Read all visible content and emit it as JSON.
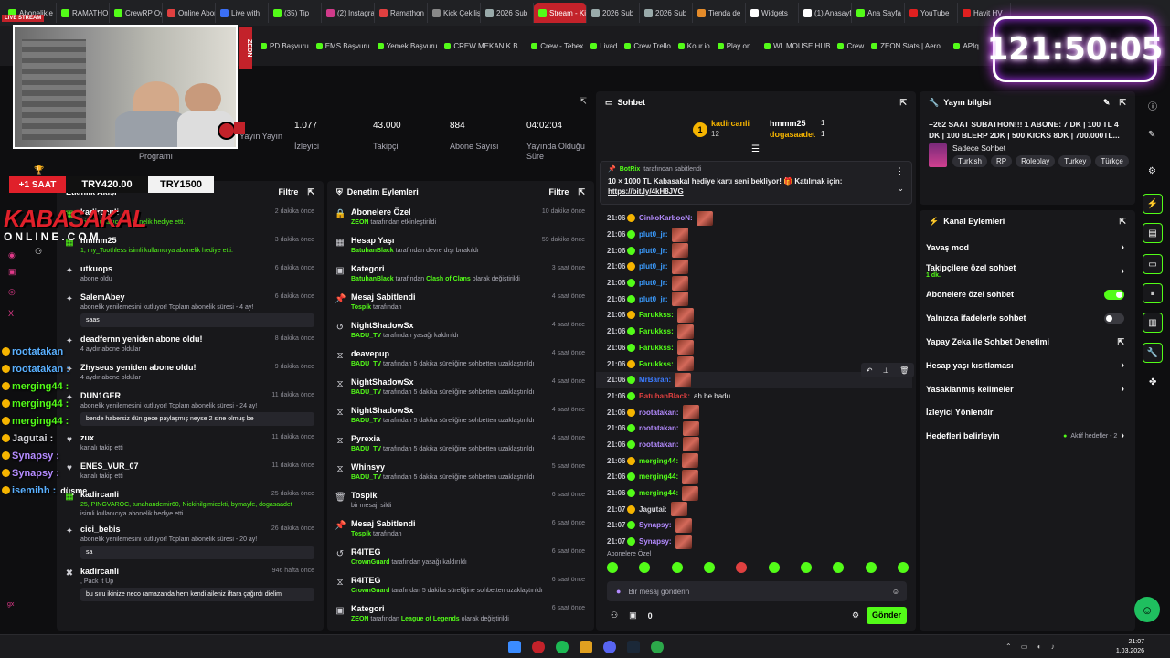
{
  "browser": {
    "tabs": [
      {
        "label": "Abonelikle",
        "color": "#53fc18"
      },
      {
        "label": "RAMATHON",
        "color": "#53fc18"
      },
      {
        "label": "CrewRP Oyun",
        "color": "#53fc18"
      },
      {
        "label": "Online Abone",
        "color": "#e04040"
      },
      {
        "label": "Live with",
        "color": "#3b6ff5"
      },
      {
        "label": "(35) Tip",
        "color": "#53fc18"
      },
      {
        "label": "(2) Instagram",
        "color": "#d03a8a"
      },
      {
        "label": "Ramathon",
        "color": "#e04040"
      },
      {
        "label": "Kick Çekiliş",
        "color": "#888"
      },
      {
        "label": "2026 Sub",
        "color": "#9aa"
      },
      {
        "label": "Stream - Kick Dash",
        "color": "#53fc18",
        "active": true
      },
      {
        "label": "2026 Sub",
        "color": "#9aa"
      },
      {
        "label": "2026 Sub",
        "color": "#9aa"
      },
      {
        "label": "Tienda de",
        "color": "#e48b2a"
      },
      {
        "label": "Widgets",
        "color": "#fff"
      },
      {
        "label": "(1) Anasayfa",
        "color": "#fff"
      },
      {
        "label": "Ana Sayfa",
        "color": "#53fc18"
      },
      {
        "label": "YouTube",
        "color": "#e02020"
      },
      {
        "label": "Havit HV",
        "color": "#e02020"
      }
    ],
    "bookmarks": [
      "PD Başvuru",
      "EMS Başvuru",
      "Yemek Başvuru",
      "CREW MEKANİK B...",
      "Crew - Tebex",
      "Livad",
      "Crew Trello",
      "Kour.io",
      "Play on...",
      "WL MOUSE HUB",
      "Crew",
      "ZEON Stats | Aero...",
      "APIq"
    ]
  },
  "overlay": {
    "live_label": "LIVE STREAM",
    "sidebar_brand": "ZEON",
    "timer": "121:50:05",
    "sub_time": "+1 SAAT",
    "price1": "TRY420.00",
    "price2": "TRY1500",
    "logo_main": "KABASAKAL",
    "logo_sub": "ONLINE.COM",
    "chat_names": [
      "rootatakan",
      "rootatakan :",
      "merging44 :",
      "merging44 :",
      "merging44 :",
      "Jagutai :",
      "Synapsy :",
      "Synapsy :",
      "isemihh :"
    ],
    "chat_last_message": "düşme"
  },
  "stats": {
    "items": [
      {
        "value": "",
        "label": "Yayın Yayın"
      },
      {
        "value": "1.077",
        "label": "İzleyici"
      },
      {
        "value": "43.000",
        "label": "Takipçi"
      },
      {
        "value": "884",
        "label": "Abone Sayısı"
      },
      {
        "value": "04:02:04",
        "label": "Yayında Olduğu Süre"
      }
    ],
    "extra_label": "Programı"
  },
  "activity": {
    "title": "Etkinlik Akışı",
    "filter": "Filtre",
    "items": [
      {
        "title": "kadircanli",
        "sub": "isimli kullanıcıya abonelik hediye etti.",
        "time": "2 dakika önce",
        "icon": "gift"
      },
      {
        "title": "hmmm25",
        "sub": "1, my_Toothless isimli kullanıcıya abonelik hediye etti.",
        "time": "3 dakika önce",
        "icon": "gift"
      },
      {
        "title": "utkuops",
        "sub": "abone oldu",
        "time": "6 dakika önce",
        "icon": "star"
      },
      {
        "title": "SalemAbey",
        "sub": "abonelik yenilemesini kutluyor! Toplam abonelik süresi - 4 ay!",
        "msg": "saas",
        "time": "6 dakika önce",
        "icon": "star"
      },
      {
        "title": "deadfernn yeniden abone oldu!",
        "sub": "4 aydır abone oldular",
        "time": "8 dakika önce",
        "icon": "star"
      },
      {
        "title": "Zhyseus yeniden abone oldu!",
        "sub": "4 aydır abone oldular",
        "time": "9 dakika önce",
        "icon": "star"
      },
      {
        "title": "DUN1GER",
        "sub": "abonelik yenilemesini kutluyor! Toplam abonelik süresi - 24 ay!",
        "msg": "bende habersiz dün gece paylaşmış neyse 2 sine olmuş be",
        "time": "11 dakika önce",
        "icon": "star"
      },
      {
        "title": "zux",
        "sub": "kanalı takip etti",
        "time": "11 dakika önce",
        "icon": "heart"
      },
      {
        "title": "ENES_VUR_07",
        "sub": "kanalı takip etti",
        "time": "11 dakika önce",
        "icon": "heart"
      },
      {
        "title": "kadircanli",
        "sub": "25, PINGVAROC, tunahandemir60, Nickinilgimicekti, bymayfe, dogasaadet",
        "sub2": "isimli kullanıcıya abonelik hediye etti.",
        "time": "25 dakika önce",
        "icon": "gift"
      },
      {
        "title": "cici_bebis",
        "sub": "abonelik yenilemesini kutluyor! Toplam abonelik süresi - 20 ay!",
        "msg": "sa",
        "time": "26 dakika önce",
        "icon": "star"
      },
      {
        "title": "kadircanli",
        "sub": ", Pack It Up",
        "msg": "bu sıru ikinize neco ramazanda hem kendi aileniz iftara çağırdı dielim",
        "time": "946 hafta önce",
        "icon": "x"
      }
    ]
  },
  "moderation": {
    "title": "Denetim Eylemleri",
    "filter": "Filtre",
    "items": [
      {
        "title": "Abonelere Özel",
        "who": "ZEON",
        "rest": "tarafından etkinleştirildi",
        "time": "10 dakika önce",
        "icon": "lock"
      },
      {
        "title": "Hesap Yaşı",
        "who": "BatuhanBlack",
        "rest": "tarafından devre dışı bırakıldı",
        "time": "59 dakika önce",
        "icon": "cal"
      },
      {
        "title": "Kategori",
        "who": "BatuhanBlack",
        "rest": "tarafından",
        "extra": "Clash of Clans",
        "rest2": "olarak değiştirildi",
        "time": "3 saat önce",
        "icon": "cat"
      },
      {
        "title": "Mesaj Sabitlendi",
        "who": "Tospik",
        "rest": "tarafından",
        "time": "4 saat önce",
        "icon": "pin"
      },
      {
        "title": "NightShadowSx",
        "who": "BADU_TV",
        "rest": "tarafından yasağı kaldırıldı",
        "time": "4 saat önce",
        "icon": "undo"
      },
      {
        "title": "deavepup",
        "who": "BADU_TV",
        "rest": "tarafından 5 dakika süreliğine sohbetten uzaklaştırıldı",
        "time": "4 saat önce",
        "icon": "hour"
      },
      {
        "title": "NightShadowSx",
        "who": "BADU_TV",
        "rest": "tarafından 5 dakika süreliğine sohbetten uzaklaştırıldı",
        "time": "4 saat önce",
        "icon": "hour"
      },
      {
        "title": "NightShadowSx",
        "who": "BADU_TV",
        "rest": "tarafından 5 dakika süreliğine sohbetten uzaklaştırıldı",
        "time": "4 saat önce",
        "icon": "hour"
      },
      {
        "title": "Pyrexia",
        "who": "BADU_TV",
        "rest": "tarafından 5 dakika süreliğine sohbetten uzaklaştırıldı",
        "time": "4 saat önce",
        "icon": "hour"
      },
      {
        "title": "Whinsyy",
        "who": "BADU_TV",
        "rest": "tarafından 5 dakika süreliğine sohbetten uzaklaştırıldı",
        "time": "5 saat önce",
        "icon": "hour"
      },
      {
        "title": "Tospik",
        "who": "",
        "rest": "bir mesajı sildi",
        "time": "6 saat önce",
        "icon": "del"
      },
      {
        "title": "Mesaj Sabitlendi",
        "who": "Tospik",
        "rest": "tarafından",
        "time": "6 saat önce",
        "icon": "pin"
      },
      {
        "title": "R4ITEG",
        "who": "CrownGuard",
        "rest": "tarafından yasağı kaldırıldı",
        "time": "6 saat önce",
        "icon": "undo"
      },
      {
        "title": "R4ITEG",
        "who": "CrownGuard",
        "rest": "tarafından 5 dakika süreliğine sohbetten uzaklaştırıldı",
        "time": "6 saat önce",
        "icon": "hour"
      },
      {
        "title": "Kategori",
        "who": "ZEON",
        "rest": "tarafından",
        "extra": "League of Legends",
        "rest2": "olarak değiştirildi",
        "time": "6 saat önce",
        "icon": "cat"
      }
    ]
  },
  "chat": {
    "title": "Sohbet",
    "top": [
      {
        "rank": "1",
        "name": "kadircanli",
        "count": "12"
      },
      {
        "rank": "",
        "name": "hmmm25",
        "count": "1"
      },
      {
        "rank": "",
        "name": "dogasaadet",
        "count": "1"
      }
    ],
    "pinned": {
      "bot": "BotRix",
      "by": "tarafından sabitlendi",
      "text": "10 × 1000 TL Kabasakal hediye kartı seni bekliyor! 🎁 Katılmak için:",
      "link": "https://bit.ly/4kH8JVG"
    },
    "messages": [
      {
        "time": "21:06",
        "name": "CinkoKarbooN:",
        "color": "#b48bff"
      },
      {
        "time": "21:06",
        "name": "plut0_jr:",
        "color": "#3b9cff"
      },
      {
        "time": "21:06",
        "name": "plut0_jr:",
        "color": "#3b9cff"
      },
      {
        "time": "21:06",
        "name": "plut0_jr:",
        "color": "#3b9cff"
      },
      {
        "time": "21:06",
        "name": "plut0_jr:",
        "color": "#3b9cff"
      },
      {
        "time": "21:06",
        "name": "plut0_jr:",
        "color": "#3b9cff"
      },
      {
        "time": "21:06",
        "name": "Farukkss:",
        "color": "#53fc18"
      },
      {
        "time": "21:06",
        "name": "Farukkss:",
        "color": "#53fc18"
      },
      {
        "time": "21:06",
        "name": "Farukkss:",
        "color": "#53fc18"
      },
      {
        "time": "21:06",
        "name": "Farukkss:",
        "color": "#53fc18"
      },
      {
        "time": "21:06",
        "name": "MrBaran:",
        "color": "#3b7bff"
      },
      {
        "time": "21:06",
        "name": "BatuhanBlack:",
        "color": "#e04040",
        "text": "ah be badu"
      },
      {
        "time": "21:06",
        "name": "rootatakan:",
        "color": "#b48bff"
      },
      {
        "time": "21:06",
        "name": "rootatakan:",
        "color": "#b48bff"
      },
      {
        "time": "21:06",
        "name": "rootatakan:",
        "color": "#b48bff"
      },
      {
        "time": "21:06",
        "name": "merging44:",
        "color": "#53fc18"
      },
      {
        "time": "21:06",
        "name": "merging44:",
        "color": "#53fc18"
      },
      {
        "time": "21:06",
        "name": "merging44:",
        "color": "#53fc18"
      },
      {
        "time": "21:07",
        "name": "Jagutai:",
        "color": "#d0d0d6"
      },
      {
        "time": "21:07",
        "name": "Synapsy:",
        "color": "#b48bff"
      },
      {
        "time": "21:07",
        "name": "Synapsy:",
        "color": "#b48bff"
      }
    ],
    "emote_section": "Abonelere Özel",
    "input_placeholder": "Bir mesaj gönderin",
    "count": "0",
    "send": "Gönder"
  },
  "info": {
    "title": "Yayın bilgisi",
    "stream_title": "+262 SAAT SUBATHON!!! 1 ABONE: 7 DK | 100 TL 4 DK | 100 BLERP 2DK | 500 KICKS 8DK | 700.000TL...",
    "category": "Sadece Sohbet",
    "tags": [
      "Turkish",
      "RP",
      "Roleplay",
      "Turkey",
      "Türkçe"
    ]
  },
  "actions": {
    "title": "Kanal Eylemleri",
    "rows": [
      {
        "label": "Yavaş mod",
        "type": "chev"
      },
      {
        "label": "Takipçilere özel sohbet",
        "sub": "1 dk.",
        "type": "chev"
      },
      {
        "label": "Abonelere özel sohbet",
        "type": "on"
      },
      {
        "label": "Yalnızca ifadelerle sohbet",
        "type": "off"
      },
      {
        "label": "Yapay Zeka ile Sohbet Denetimi",
        "type": "ext"
      },
      {
        "label": "Hesap yaşı kısıtlaması",
        "type": "chev"
      },
      {
        "label": "Yasaklanmış kelimeler",
        "type": "chev"
      },
      {
        "label": "İzleyici Yönlendir",
        "type": "none"
      },
      {
        "label": "Hedefleri belirleyin",
        "type": "goal",
        "extra": "Aktif hedefler - 2"
      }
    ]
  },
  "clock": {
    "time": "21:07",
    "date": "1.03.2026"
  },
  "colors": {
    "accent": "#53fc18",
    "bg": "#0e0e10",
    "panel": "#18181b"
  }
}
